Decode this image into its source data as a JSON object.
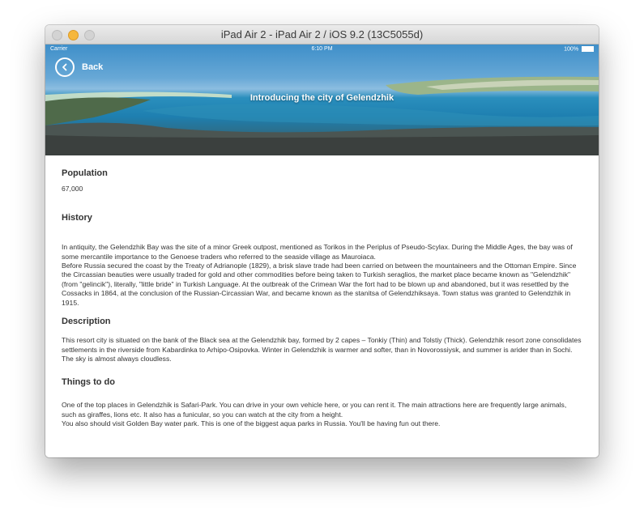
{
  "simulator": {
    "title": "iPad Air 2 - iPad Air 2 / iOS 9.2 (13C5055d)"
  },
  "statusbar": {
    "carrier": "Carrier",
    "time": "6:10 PM",
    "battery": "100%"
  },
  "header": {
    "back_label": "Back",
    "title": "Introducing the city of Gelendzhik"
  },
  "sections": {
    "population": {
      "title": "Population",
      "value": "67,000"
    },
    "history": {
      "title": "History",
      "text": "In antiquity, the Gelendzhik Bay was the site of a minor Greek outpost, mentioned as Torikos in the Periplus of Pseudo-Scylax. During the Middle Ages, the bay was of some mercantile importance to the Genoese traders who referred to the seaside village as Mauroiaca.\nBefore Russia secured the coast by the Treaty of Adrianople (1829), a brisk slave trade had been carried on between the mountaineers and the Ottoman Empire. Since the Circassian beauties were usually traded for gold and other commodities before being taken to Turkish seraglios, the market place became known as \"Gelendzhik\" (from \"gelincik\"), literally, \"little bride\" in Turkish Language. At the outbreak of the Crimean War the fort had to be blown up and abandoned, but it was resettled by the Cossacks in 1864, at the conclusion of the Russian-Circassian War, and became known as the stanitsa of Gelendzhiksaya. Town status was granted to Gelendzhik in 1915."
    },
    "description": {
      "title": "Description",
      "text": "This resort city is situated on the bank of the Black sea at the Gelendzhik bay, formed by 2 capes – Tonkiy (Thin) and Tolstiy (Thick). Gelendzhik resort zone consolidates settlements in the riverside from Kabardinka to Arhipo-Osipovka. Winter in Gelendzhik is warmer and softer, than in Novorossiysk, and summer is arider than in Sochi. The sky is almost always cloudless."
    },
    "things_to_do": {
      "title": "Things to do",
      "text": "One of the top places in Gelendzhik is Safari-Park. You can drive in your own vehicle here, or you can rent it. The main attractions here are frequently large animals, such as giraffes, lions etc. It also has a funicular, so you can watch at the city from a height.\nYou also should visit Golden Bay water park. This is one of the biggest aqua parks in Russia. You'll be having fun out there."
    }
  }
}
